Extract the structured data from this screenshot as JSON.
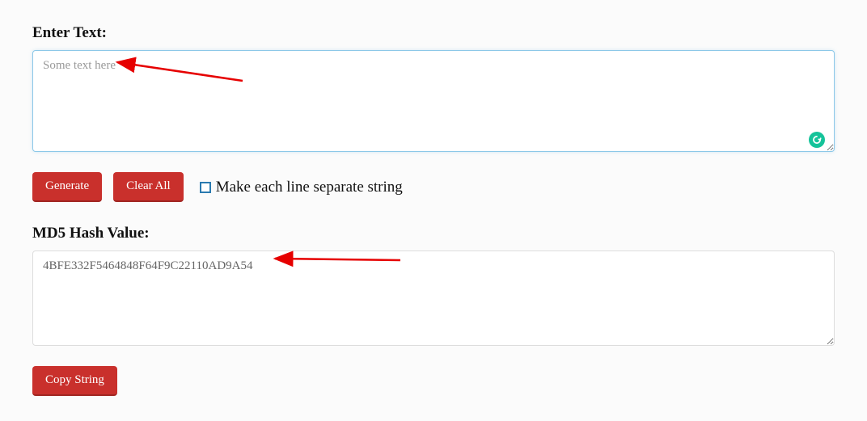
{
  "input": {
    "label": "Enter Text:",
    "value": "Some text here"
  },
  "buttons": {
    "generate": "Generate",
    "clear_all": "Clear All",
    "copy_string": "Copy String"
  },
  "checkbox": {
    "label": "Make each line separate string",
    "checked": false
  },
  "output": {
    "label": "MD5 Hash Value:",
    "value": "4BFE332F5464848F64F9C22110AD9A54"
  }
}
